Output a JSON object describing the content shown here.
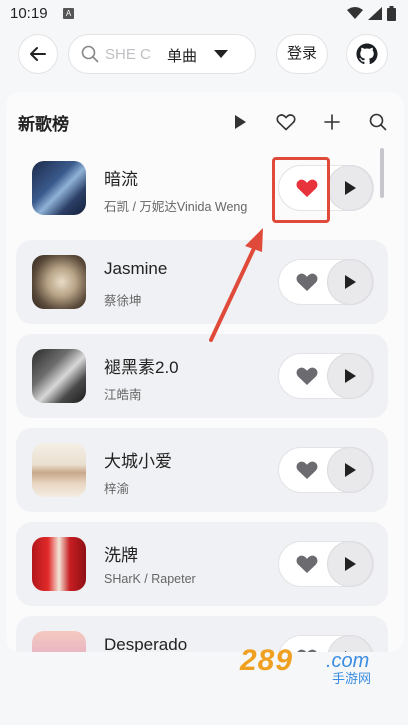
{
  "status_bar": {
    "time": "10:19",
    "badge": "A"
  },
  "header": {
    "search_placeholder": "SHE C",
    "search_type": "单曲",
    "login_label": "登录"
  },
  "chart": {
    "title": "新歌榜"
  },
  "songs": [
    {
      "name": "暗流",
      "artist": "石凯 / 万妮达Vinida Weng",
      "liked": true
    },
    {
      "name": "Jasmine",
      "artist": "蔡徐坤",
      "liked": false
    },
    {
      "name": "褪黑素2.0",
      "artist": "江皓南",
      "liked": false
    },
    {
      "name": "大城小爱",
      "artist": "梓渝",
      "liked": false
    },
    {
      "name": "洗牌",
      "artist": "SHarK / Rapeter",
      "liked": false
    },
    {
      "name": "Desperado",
      "artist": "",
      "liked": false
    }
  ],
  "watermark": {
    "number": "289",
    "domain": ".com",
    "text": "手游网"
  },
  "colors": {
    "accent_red": "#e8323c",
    "annotation": "#e04a3a",
    "watermark_orange": "#f0a020",
    "watermark_blue": "#3a8de0"
  }
}
